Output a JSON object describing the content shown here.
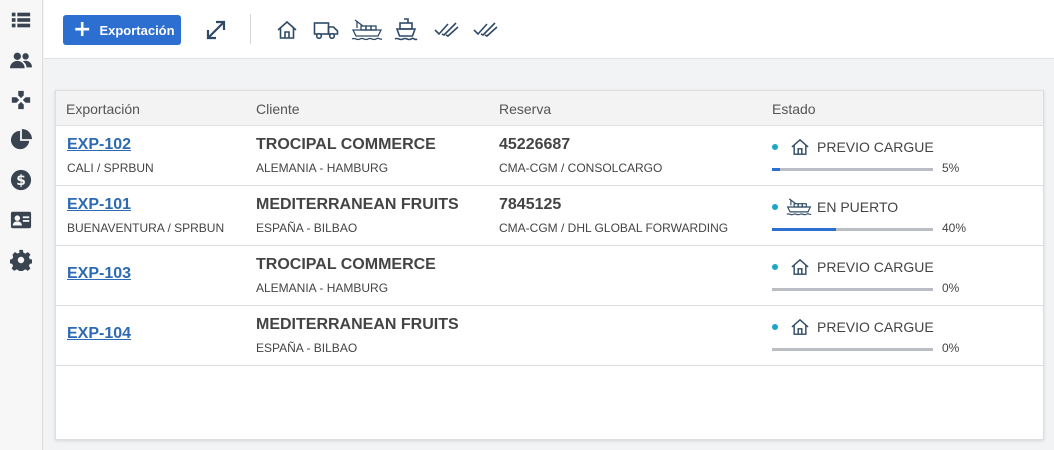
{
  "sidebar": {
    "items": [
      {
        "icon": "list-icon"
      },
      {
        "icon": "users-icon"
      },
      {
        "icon": "modules-icon"
      },
      {
        "icon": "pie-chart-icon"
      },
      {
        "icon": "dollar-icon"
      },
      {
        "icon": "contact-card-icon"
      },
      {
        "icon": "gear-icon"
      }
    ]
  },
  "toolbar": {
    "new_label": "Exportación",
    "icons": [
      "expand-icon",
      "house-icon",
      "truck-icon",
      "port-icon",
      "ship-icon",
      "double-check-icon",
      "double-check-icon"
    ]
  },
  "table": {
    "headers": [
      "Exportación",
      "Cliente",
      "Reserva",
      "Estado"
    ],
    "rows": [
      {
        "code": "EXP-102",
        "route": "CALI / SPRBUN",
        "client": "TROCIPAL COMMERCE",
        "destination": "ALEMANIA - HAMBURG",
        "booking": "45226687",
        "carrier": "CMA-CGM / CONSOLCARGO",
        "status": "PREVIO CARGUE",
        "status_icon": "house-icon",
        "progress_label": "5%",
        "progress": 0.05
      },
      {
        "code": "EXP-101",
        "route": "BUENAVENTURA / SPRBUN",
        "client": "MEDITERRANEAN FRUITS",
        "destination": "ESPAÑA - BILBAO",
        "booking": "7845125",
        "carrier": "CMA-CGM / DHL GLOBAL FORWARDING",
        "status": "EN PUERTO",
        "status_icon": "port-icon",
        "progress_label": "40%",
        "progress": 0.4
      },
      {
        "code": "EXP-103",
        "route": "",
        "client": "TROCIPAL COMMERCE",
        "destination": "ALEMANIA - HAMBURG",
        "booking": "",
        "carrier": "",
        "status": "PREVIO CARGUE",
        "status_icon": "house-icon",
        "progress_label": "0%",
        "progress": 0
      },
      {
        "code": "EXP-104",
        "route": "",
        "client": "MEDITERRANEAN FRUITS",
        "destination": "ESPAÑA - BILBAO",
        "booking": "",
        "carrier": "",
        "status": "PREVIO CARGUE",
        "status_icon": "house-icon",
        "progress_label": "0%",
        "progress": 0
      }
    ]
  },
  "colors": {
    "accent": "#2d6fd0",
    "status_dot": "#1aa6c8",
    "link": "#2c6ab3"
  }
}
